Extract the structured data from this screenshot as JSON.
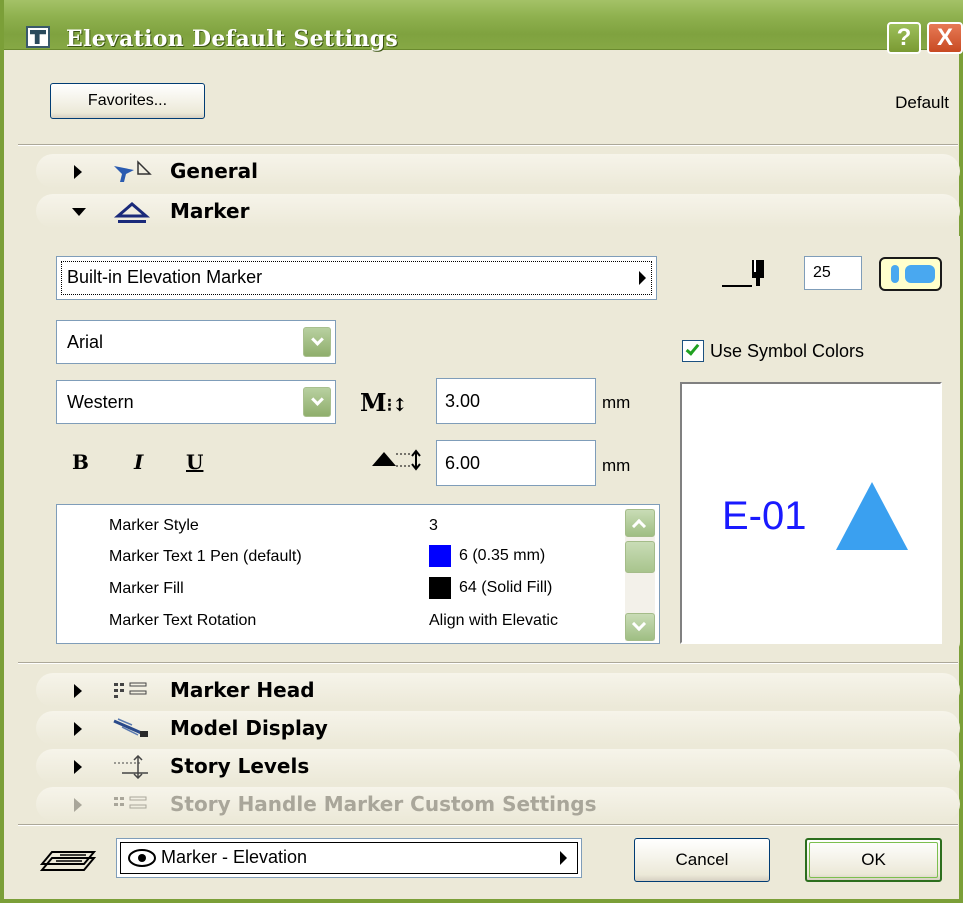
{
  "window": {
    "title": "Elevation Default Settings",
    "help_label": "?",
    "close_label": "X"
  },
  "toolbar": {
    "favorites_label": "Favorites...",
    "default_label": "Default"
  },
  "panels": {
    "general": {
      "label": "General",
      "icon": "general-panel-icon"
    },
    "marker": {
      "label": "Marker",
      "icon": "marker-panel-icon",
      "expanded": true
    },
    "marker_head": {
      "label": "Marker Head",
      "icon": "marker-head-icon"
    },
    "model_display": {
      "label": "Model Display",
      "icon": "model-display-icon"
    },
    "story_levels": {
      "label": "Story Levels",
      "icon": "story-levels-icon"
    },
    "story_handle": {
      "label": "Story Handle Marker Custom Settings",
      "icon": "story-handle-icon",
      "disabled": true
    }
  },
  "marker": {
    "marker_type": "Built-in Elevation Marker",
    "pen_value": "25",
    "font": "Arial",
    "script": "Western",
    "bold_label": "B",
    "italic_label": "I",
    "underline_label": "U",
    "size_value": "3.00",
    "size_unit": "mm",
    "height_value": "6.00",
    "height_unit": "mm",
    "use_symbol_colors_label": "Use Symbol Colors",
    "use_symbol_colors": true,
    "params": [
      {
        "name": "Marker Style",
        "value": "3",
        "swatch": null
      },
      {
        "name": "Marker Text 1 Pen (default)",
        "value": "6 (0.35 mm)",
        "swatch": "#0000ff"
      },
      {
        "name": "Marker Fill",
        "value": "64 (Solid Fill)",
        "swatch": "#000000"
      },
      {
        "name": "Marker Text Rotation",
        "value": "Align with Elevatic",
        "swatch": null
      }
    ],
    "preview_code": "E-01",
    "preview_text_color": "#1a1aff",
    "preview_marker_color": "#3aa0f0"
  },
  "footer": {
    "layer_value": "Marker - Elevation",
    "cancel_label": "Cancel",
    "ok_label": "OK"
  },
  "colors": {
    "titlebar": "#8eb04e",
    "dialog_bg": "#ece9d8"
  }
}
